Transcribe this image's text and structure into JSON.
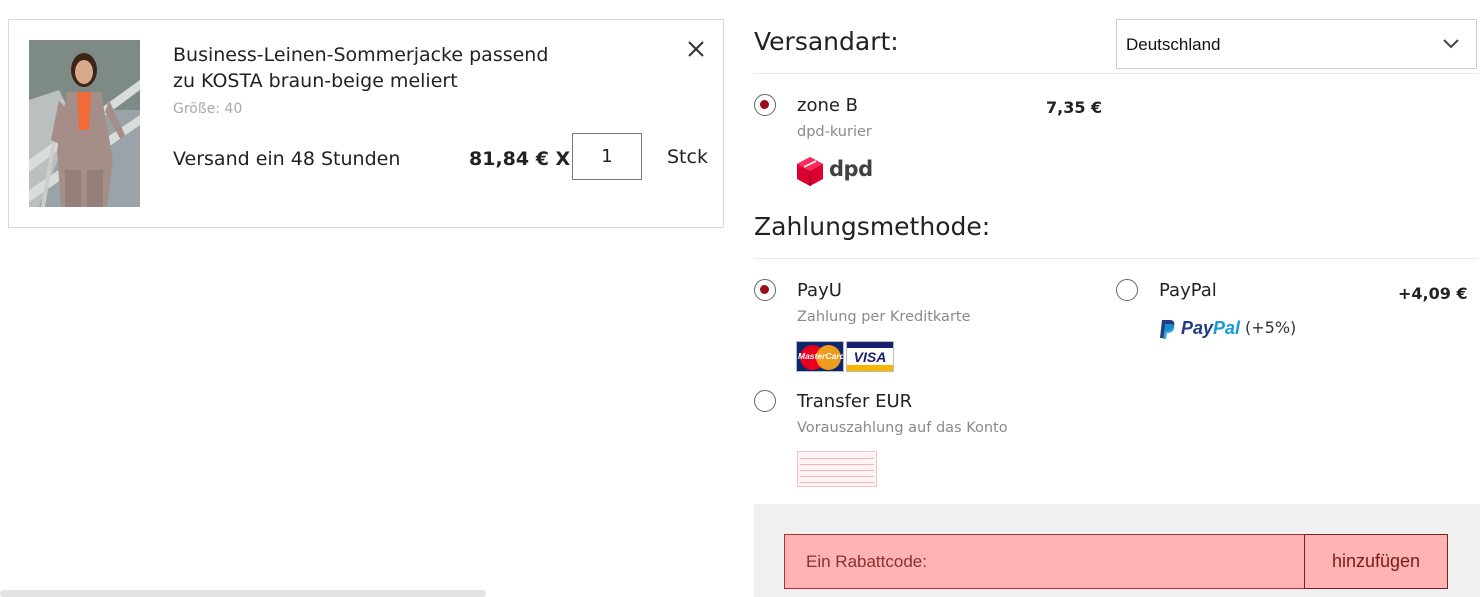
{
  "cart_item": {
    "name_line1": "Business-Leinen-Sommerjacke passend",
    "name_line2": "zu KOSTA braun-beige meliert",
    "size": "Größe: 40",
    "shipping_time": "Versand ein 48 Stunden",
    "price": "81,84 € X",
    "quantity": "1",
    "unit": "Stck",
    "remove_icon": "close-icon"
  },
  "shipping": {
    "title": "Versandart:",
    "country": "Deutschland",
    "options": [
      {
        "label": "zone B",
        "sub": "dpd-kurier",
        "price": "7,35 €",
        "selected": true,
        "logo_text": "dpd"
      }
    ]
  },
  "payment": {
    "title": "Zahlungsmethode:",
    "options": [
      {
        "label": "PayU",
        "sub": "Zahlung per Kreditkarte",
        "selected": true,
        "logos": [
          "MasterCard",
          "VISA"
        ]
      },
      {
        "label": "PayPal",
        "price": "+4,09 €",
        "selected": false,
        "logo_pay": "Pay",
        "logo_pal": "Pal",
        "fee": "(+5%)"
      },
      {
        "label": "Transfer EUR",
        "sub": "Vorauszahlung auf das Konto",
        "selected": false
      }
    ]
  },
  "discount": {
    "placeholder": "Ein Rabattcode:",
    "button_label": "hinzufügen"
  },
  "colors": {
    "accent": "#9b0d1e",
    "discount_bg": "#ffb3b3",
    "panel_bg": "#f0f0f0"
  }
}
